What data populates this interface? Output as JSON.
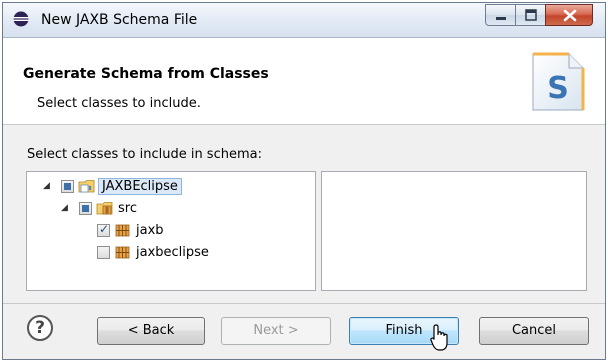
{
  "window": {
    "title": "New JAXB Schema File"
  },
  "header": {
    "title": "Generate Schema from Classes",
    "subtitle": "Select classes to include."
  },
  "content": {
    "tree_label": "Select classes to include in schema:",
    "tree": [
      {
        "label": "JAXBEclipse",
        "state": "partial",
        "expanded": true,
        "selected": true,
        "icon": "java-project-icon"
      },
      {
        "label": "src",
        "state": "partial",
        "expanded": true,
        "icon": "source-folder-icon"
      },
      {
        "label": "jaxb",
        "state": "checked",
        "icon": "package-icon"
      },
      {
        "label": "jaxbeclipse",
        "state": "unchecked",
        "icon": "package-icon"
      }
    ]
  },
  "footer": {
    "back_label": "< Back",
    "next_label": "Next >",
    "finish_label": "Finish",
    "cancel_label": "Cancel"
  },
  "colors": {
    "selection": "#dbe8f7",
    "close_button": "#c2442b",
    "default_button": "#3c7fb1"
  }
}
